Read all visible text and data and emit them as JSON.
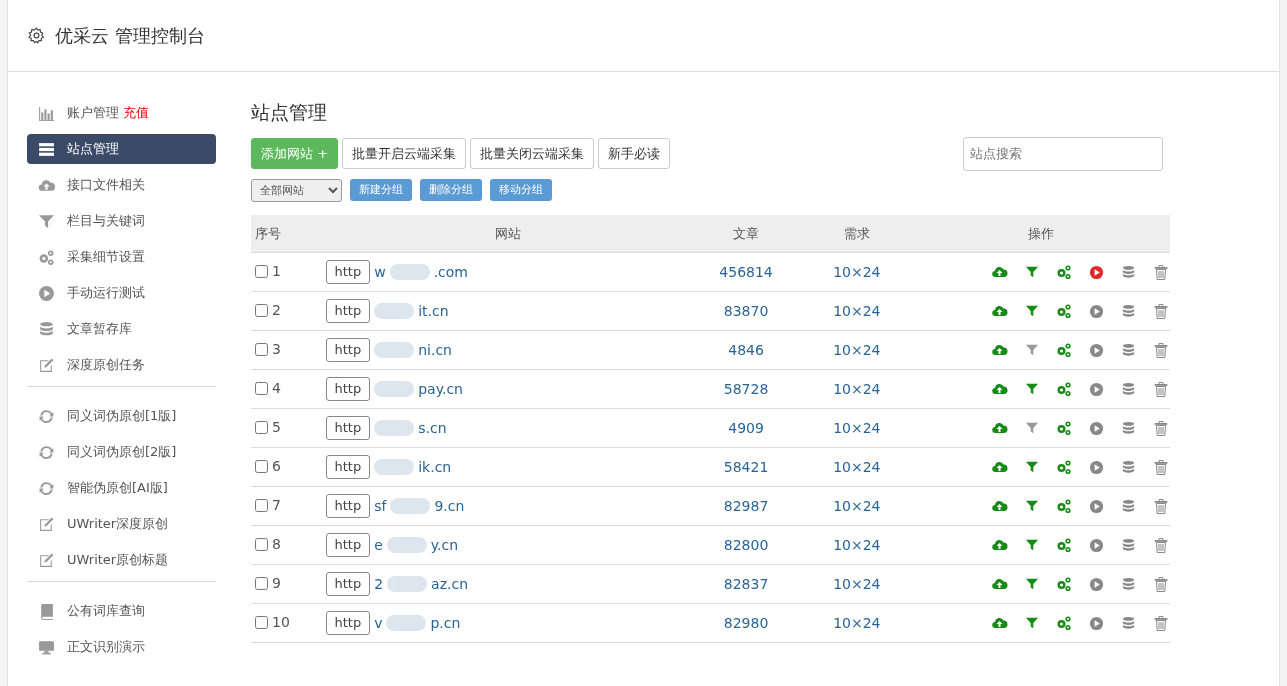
{
  "header": {
    "title": "优采云 管理控制台"
  },
  "sidebar": {
    "groups": [
      [
        {
          "label": "账户管理",
          "badge": "充值",
          "selected": false
        },
        {
          "label": "站点管理",
          "selected": true
        },
        {
          "label": "接口文件相关",
          "selected": false
        },
        {
          "label": "栏目与关键词",
          "selected": false
        },
        {
          "label": "采集细节设置",
          "selected": false
        },
        {
          "label": "手动运行测试",
          "selected": false
        },
        {
          "label": "文章暂存库",
          "selected": false
        },
        {
          "label": "深度原创任务",
          "selected": false
        }
      ],
      [
        {
          "label": "同义词伪原创[1版]",
          "selected": false
        },
        {
          "label": "同义词伪原创[2版]",
          "selected": false
        },
        {
          "label": "智能伪原创[AI版]",
          "selected": false
        },
        {
          "label": "UWriter深度原创",
          "selected": false
        },
        {
          "label": "UWriter原创标题",
          "selected": false
        }
      ],
      [
        {
          "label": "公有词库查询",
          "selected": false
        },
        {
          "label": "正文识别演示",
          "selected": false
        }
      ]
    ]
  },
  "main": {
    "title": "站点管理",
    "buttons": [
      {
        "label": "添加网站 +",
        "kind": "primary"
      },
      {
        "label": "批量开启云端采集",
        "kind": "plain"
      },
      {
        "label": "批量关闭云端采集",
        "kind": "plain"
      },
      {
        "label": "新手必读",
        "kind": "plain"
      }
    ],
    "search": {
      "placeholder": "站点搜索"
    },
    "group_select": {
      "value": "全部网站"
    },
    "group_buttons": [
      "新建分组",
      "删除分组",
      "移动分组"
    ],
    "table": {
      "columns": [
        "序号",
        "网站",
        "文章",
        "需求",
        "操作"
      ],
      "rows": [
        {
          "checked": false,
          "index": "1",
          "scheme": "http",
          "domain_start": "w",
          "domain_end": ".com",
          "articles": "456814",
          "demand": "10×24",
          "filter_on": true,
          "running": true
        },
        {
          "checked": false,
          "index": "2",
          "scheme": "http",
          "domain_end": "it.cn",
          "articles": "83870",
          "demand": "10×24",
          "filter_on": true,
          "running": false
        },
        {
          "checked": false,
          "index": "3",
          "scheme": "http",
          "domain_end": "ni.cn",
          "articles": "4846",
          "demand": "10×24",
          "filter_on": false,
          "running": false
        },
        {
          "checked": false,
          "index": "4",
          "scheme": "http",
          "domain_end": "pay.cn",
          "articles": "58728",
          "demand": "10×24",
          "filter_on": true,
          "running": false
        },
        {
          "checked": false,
          "index": "5",
          "scheme": "http",
          "domain_end": "s.cn",
          "articles": "4909",
          "demand": "10×24",
          "filter_on": false,
          "running": false
        },
        {
          "checked": false,
          "index": "6",
          "scheme": "http",
          "domain_end": "ik.cn",
          "articles": "58421",
          "demand": "10×24",
          "filter_on": true,
          "running": false
        },
        {
          "checked": false,
          "index": "7",
          "scheme": "http",
          "domain_start": "sf",
          "domain_end": "9.cn",
          "articles": "82987",
          "demand": "10×24",
          "filter_on": true,
          "running": false
        },
        {
          "checked": false,
          "index": "8",
          "scheme": "http",
          "domain_start": "e",
          "domain_end": "y.cn",
          "articles": "82800",
          "demand": "10×24",
          "filter_on": true,
          "running": false
        },
        {
          "checked": false,
          "index": "9",
          "scheme": "http",
          "domain_start": "2",
          "domain_end": "az.cn",
          "articles": "82837",
          "demand": "10×24",
          "filter_on": true,
          "running": false
        },
        {
          "checked": false,
          "index": "10",
          "scheme": "http",
          "domain_start": "v",
          "domain_end": "p.cn",
          "articles": "82980",
          "demand": "10×24",
          "filter_on": true,
          "running": false
        }
      ]
    }
  }
}
